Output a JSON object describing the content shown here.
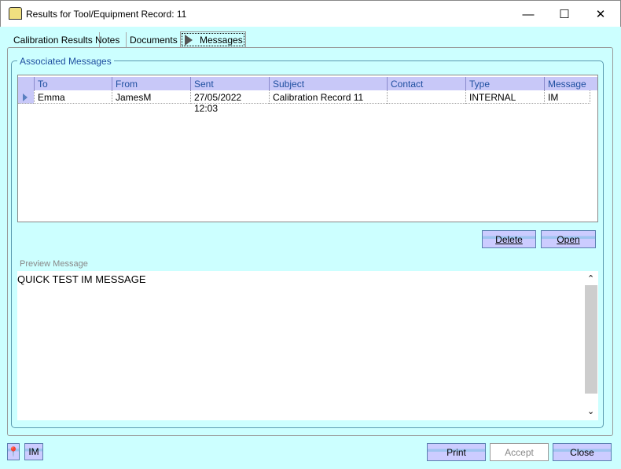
{
  "window": {
    "title": "Results for Tool/Equipment Record: 11",
    "minimize": "—",
    "maximize": "☐",
    "close": "✕"
  },
  "tabs": [
    {
      "label": "Calibration Results"
    },
    {
      "label": "Notes"
    },
    {
      "label": "Documents"
    },
    {
      "label": "Messages"
    }
  ],
  "group": {
    "label": "Associated Messages"
  },
  "grid": {
    "columns": [
      "To",
      "From",
      "Sent",
      "Subject",
      "Contact",
      "Type",
      "Message"
    ],
    "rows": [
      [
        "Emma",
        "JamesM",
        "27/05/2022 12:03",
        "Calibration Record 11",
        "",
        "INTERNAL",
        "IM"
      ]
    ]
  },
  "buttons": {
    "delete": "Delete",
    "open": "Open",
    "print": "Print",
    "accept": "Accept",
    "close": "Close",
    "im": "IM"
  },
  "preview": {
    "label": "Preview Message",
    "text": "QUICK TEST IM MESSAGE"
  }
}
